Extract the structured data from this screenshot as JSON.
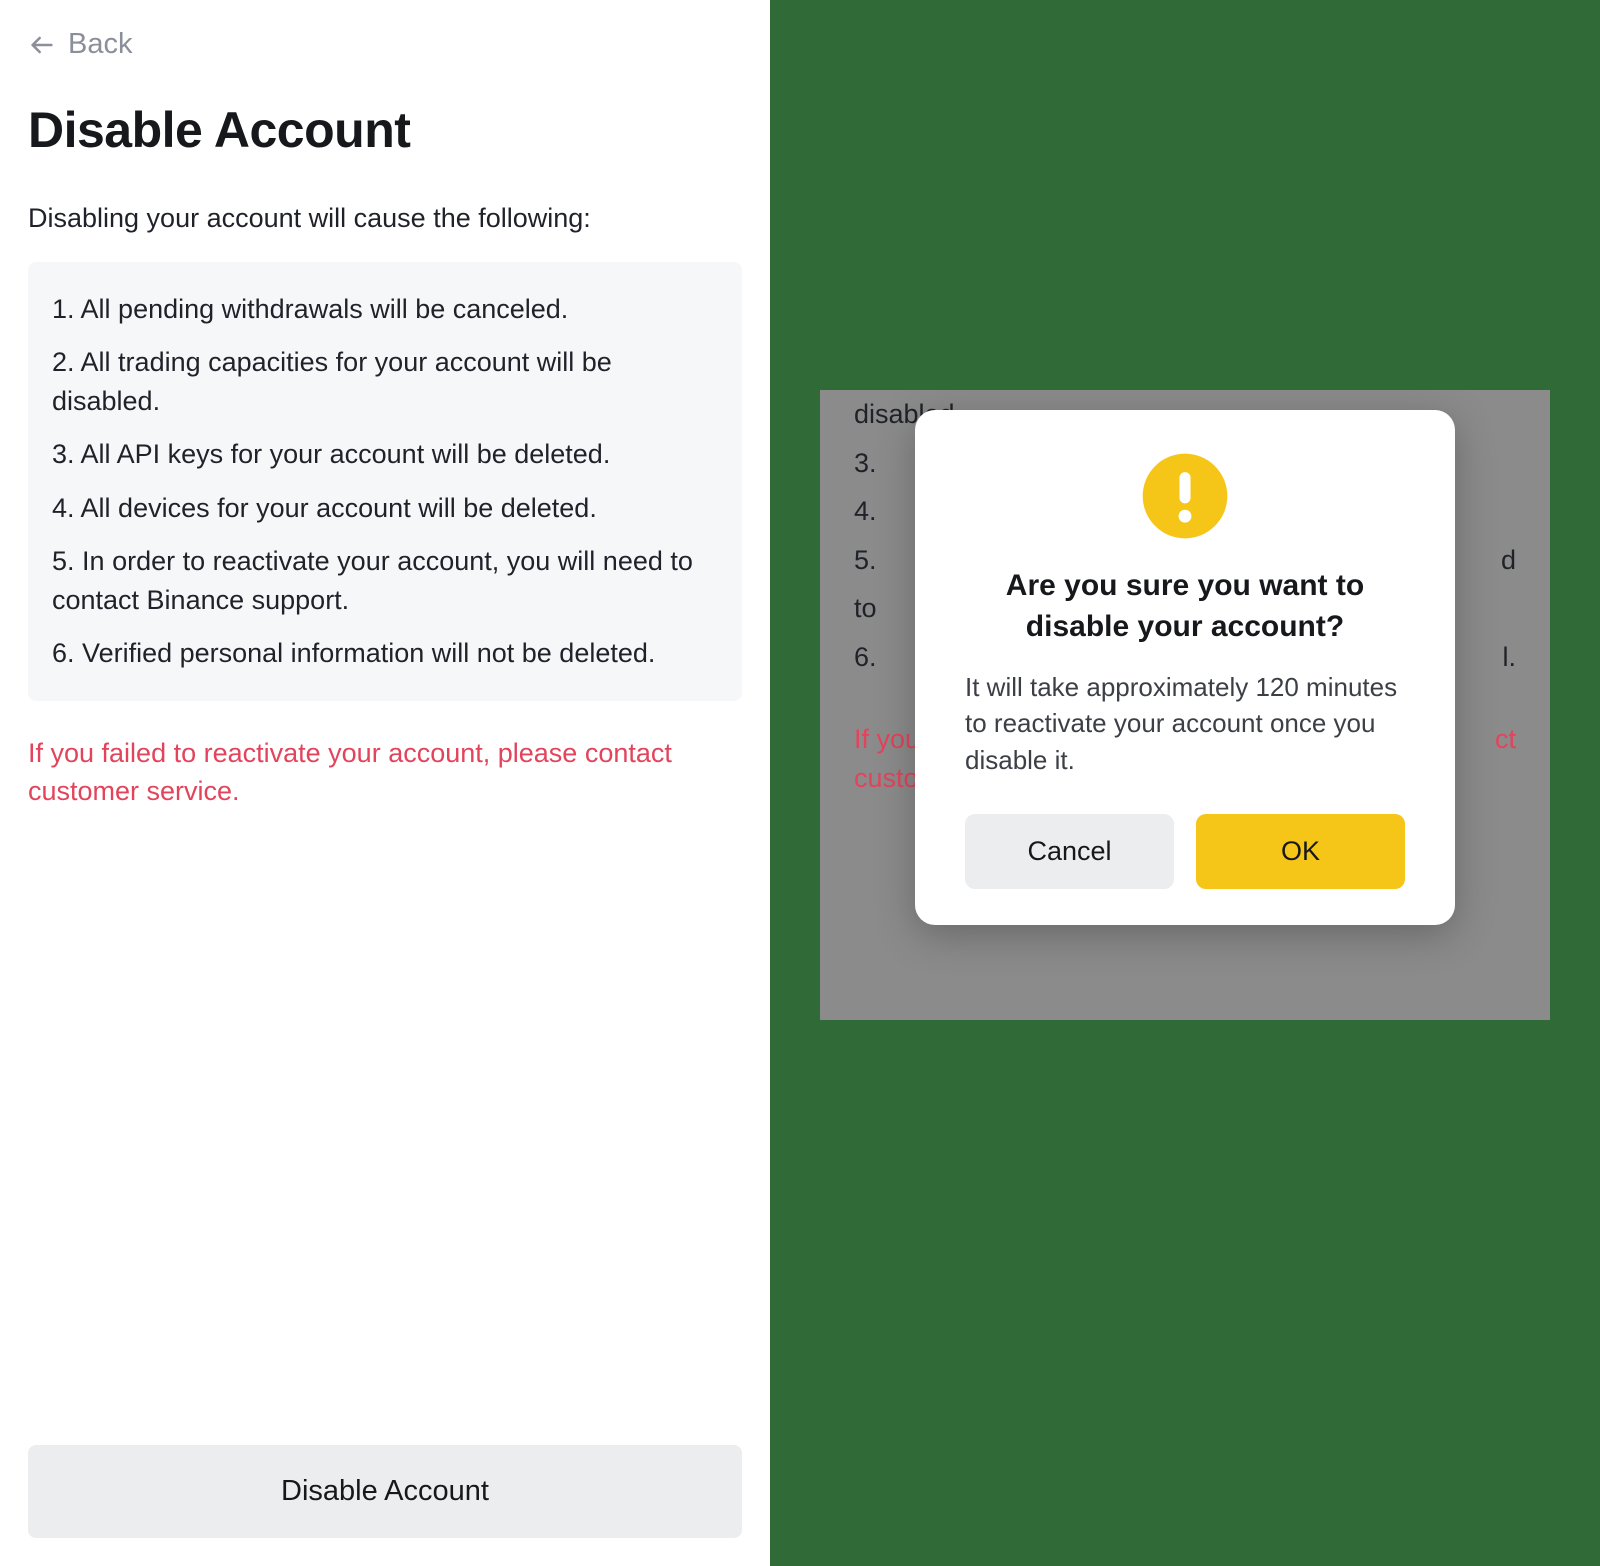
{
  "back_label": "Back",
  "page_title": "Disable Account",
  "intro_text": "Disabling your account will cause the following:",
  "consequences": [
    "All pending withdrawals will be canceled.",
    "All trading capacities for your account will be disabled.",
    "All API keys for your account will be deleted.",
    "All devices for your account will be deleted.",
    "In order to reactivate your account, you will need to contact Binance support.",
    "Verified personal information will not be deleted."
  ],
  "warning_text": "If you failed to reactivate your account, please contact customer service.",
  "disable_button_label": "Disable Account",
  "bg_fragments": {
    "line_disabled": "disabled.",
    "line_3": "3.",
    "line_4": "4.",
    "line_5_left": "5.",
    "line_5_right": "d",
    "line_to": "to",
    "line_6_left": "6.",
    "line_6_right": "l.",
    "warn_left_line1": "If you",
    "warn_right_line1": "ct",
    "warn_left_line2": "custo"
  },
  "dialog": {
    "title": "Are you sure you want to disable your account?",
    "body": "It will take approximately 120 minutes to reactivate your account once you disable it.",
    "cancel_label": "Cancel",
    "ok_label": "OK"
  },
  "colors": {
    "accent_yellow": "#f5c518",
    "warning_red": "#e2445c",
    "right_bg": "#2f6a37"
  }
}
